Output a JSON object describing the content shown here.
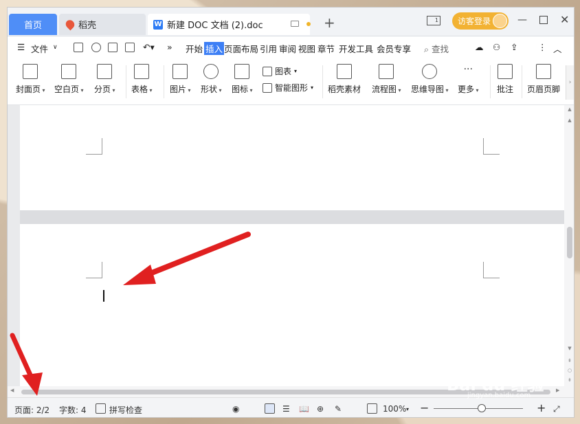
{
  "titlebar": {
    "home_tab": "首页",
    "daoke_tab": "稻壳",
    "doc_tab": "新建 DOC 文档 (2).doc",
    "login_button": "访客登录",
    "layout_badge": "1"
  },
  "menu": {
    "file": "文件",
    "items": [
      "开始",
      "插入",
      "页面布局",
      "引用",
      "审阅",
      "视图",
      "章节",
      "开发工具",
      "会员专享"
    ],
    "active": "插入",
    "search": "查找"
  },
  "ribbon": {
    "buttons": [
      "封面页",
      "空白页",
      "分页",
      "表格",
      "图片",
      "形状",
      "图标",
      "图表",
      "智能图形",
      "稻壳素材",
      "流程图",
      "思维导图",
      "更多",
      "批注",
      "页眉页脚"
    ]
  },
  "status": {
    "page": "页面: 2/2",
    "words": "字数: 4",
    "spellcheck": "拼写检查",
    "zoom": "100%"
  },
  "watermark": {
    "main": "Bai du 经验",
    "sub": "jingyan.baidu.com"
  },
  "colors": {
    "accent": "#3d7ff5",
    "home_tab": "#4f8ef7",
    "login": "#f2b233",
    "annotation_arrow": "#e02020"
  }
}
